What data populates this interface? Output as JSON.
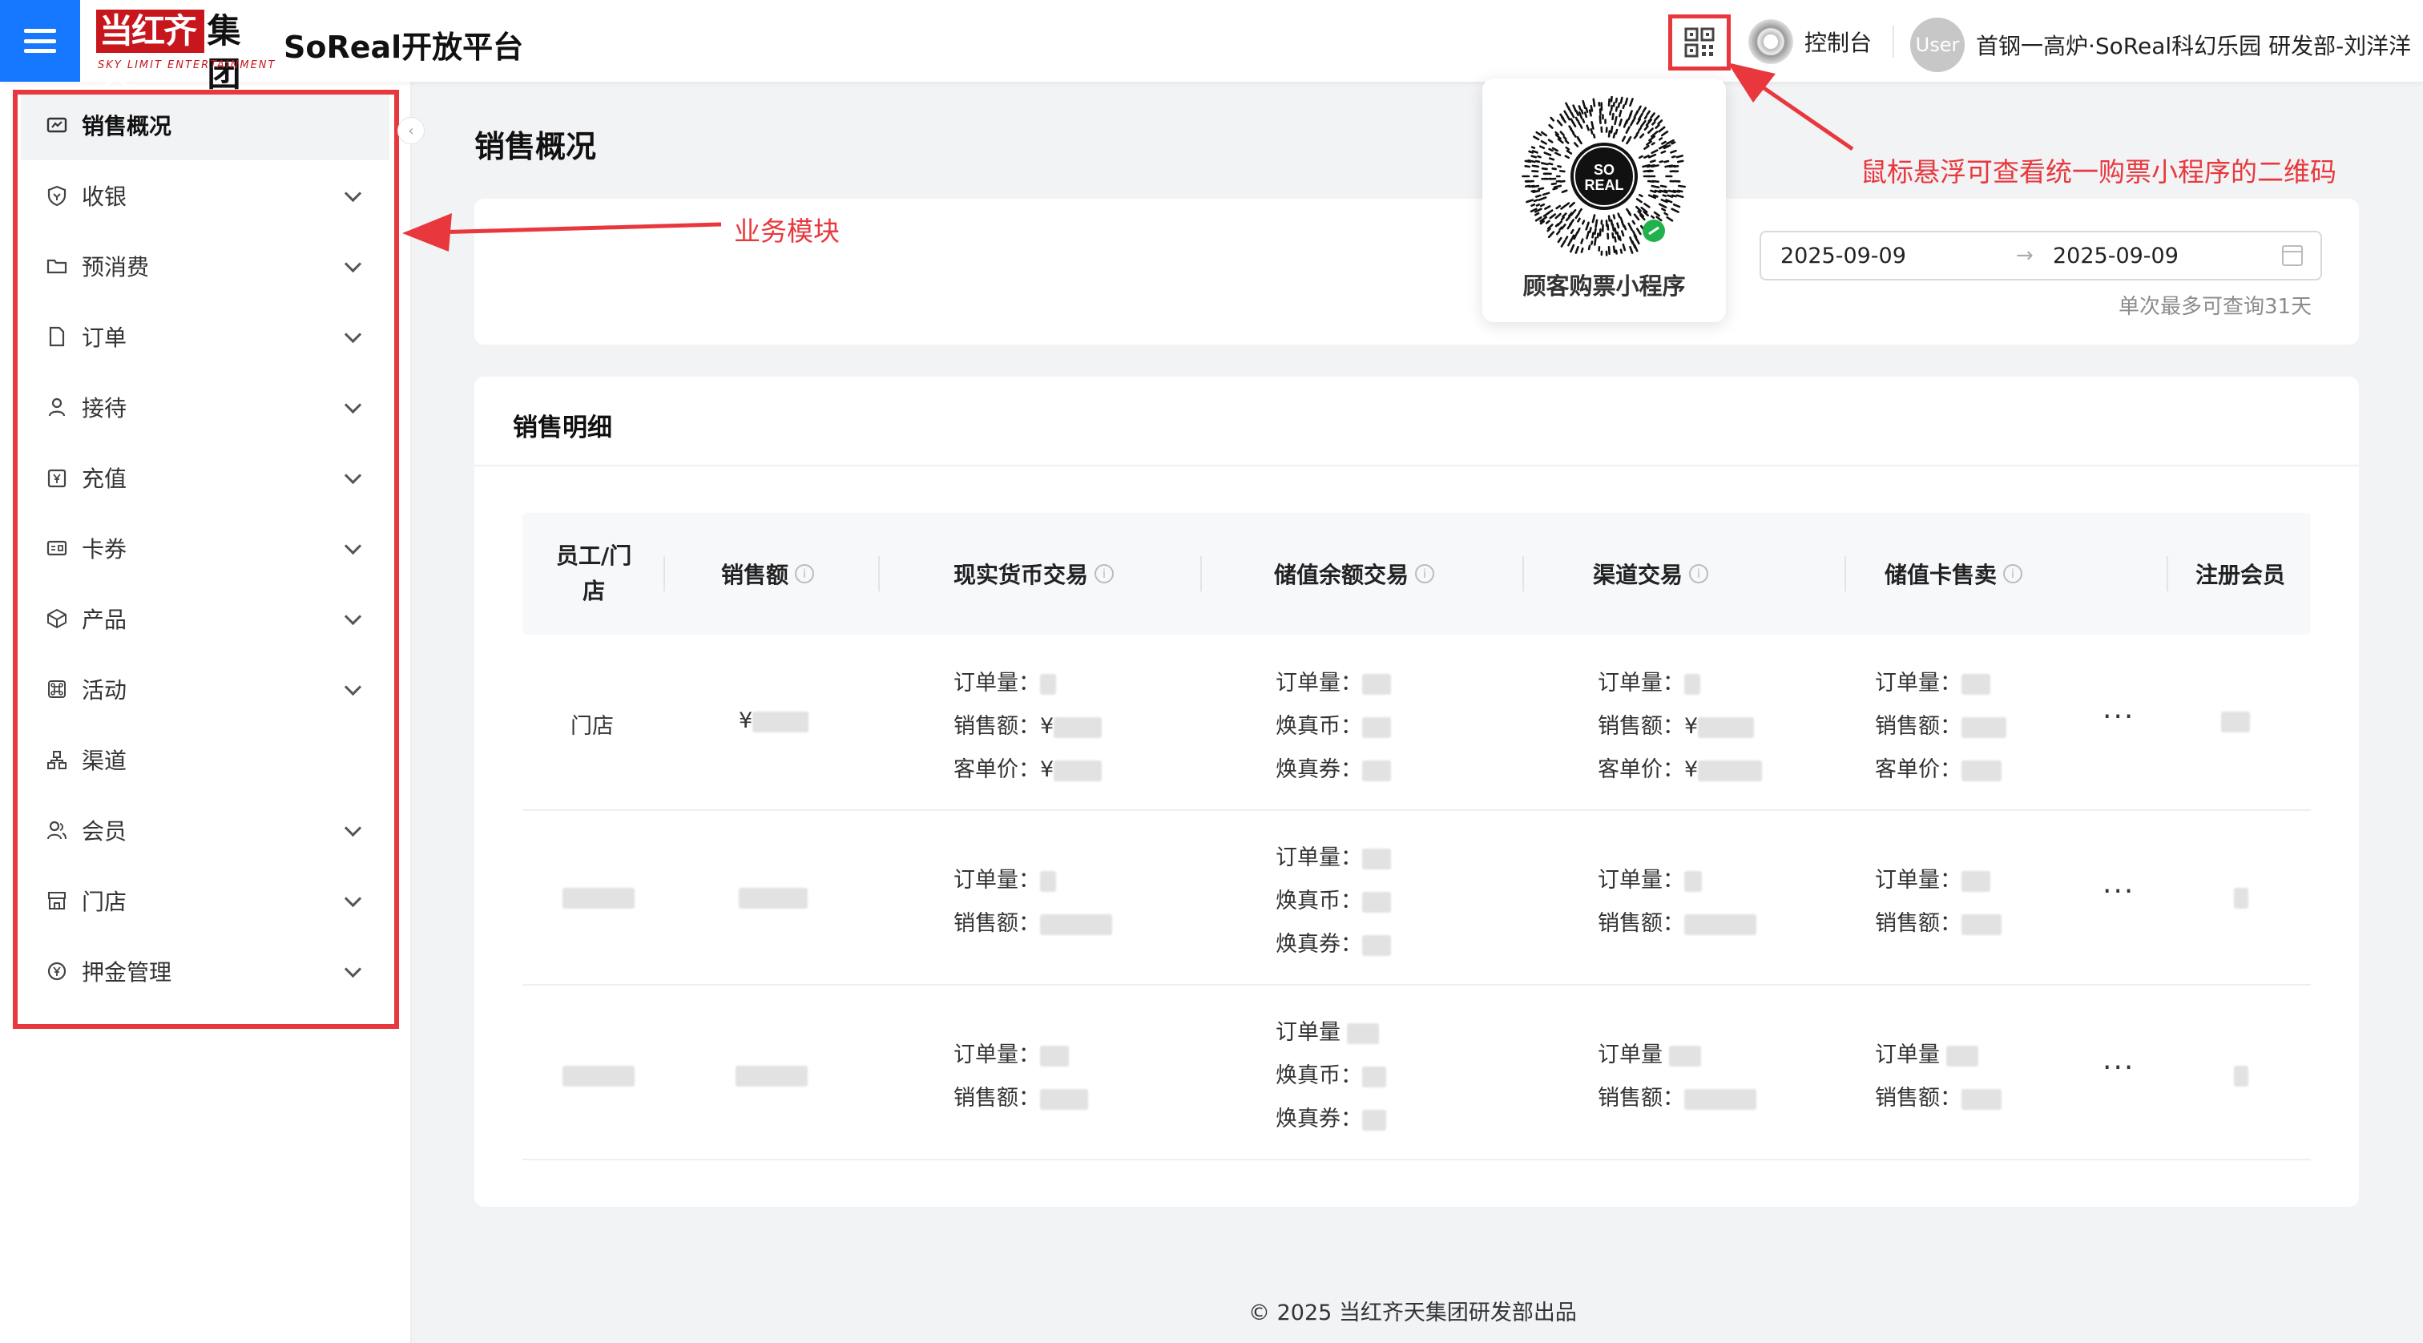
{
  "header": {
    "logo_main": "当红齐天",
    "logo_suffix": "集团",
    "logo_tagline": "SKY LIMIT ENTERTAINMENT",
    "platform_title": "SoReal开放平台",
    "console_label": "控制台",
    "avatar_text": "User",
    "user_name": "首钢一高炉·SoReal科幻乐园 研发部-刘洋洋"
  },
  "qr_popover": {
    "caption": "顾客购票小程序",
    "qr_logo_text": "SO REAL"
  },
  "sidebar": {
    "items": [
      {
        "label": "销售概况",
        "icon": "dashboard-icon",
        "expandable": false,
        "active": true
      },
      {
        "label": "收银",
        "icon": "shield-icon",
        "expandable": true
      },
      {
        "label": "预消费",
        "icon": "folder-icon",
        "expandable": true
      },
      {
        "label": "订单",
        "icon": "file-icon",
        "expandable": true
      },
      {
        "label": "接待",
        "icon": "user-icon",
        "expandable": true
      },
      {
        "label": "充值",
        "icon": "yen-calendar-icon",
        "expandable": true
      },
      {
        "label": "卡券",
        "icon": "id-card-icon",
        "expandable": true
      },
      {
        "label": "产品",
        "icon": "cube-icon",
        "expandable": true
      },
      {
        "label": "活动",
        "icon": "command-icon",
        "expandable": true
      },
      {
        "label": "渠道",
        "icon": "cluster-icon",
        "expandable": false
      },
      {
        "label": "会员",
        "icon": "members-icon",
        "expandable": true
      },
      {
        "label": "门店",
        "icon": "shop-icon",
        "expandable": true
      },
      {
        "label": "押金管理",
        "icon": "deposit-icon",
        "expandable": true
      }
    ]
  },
  "main": {
    "page_title": "销售概况",
    "date_start": "2025-09-09",
    "date_end": "2025-09-09",
    "date_arrow": "→",
    "date_hint": "单次最多可查询31天",
    "detail_title": "销售明细",
    "columns": [
      "员工/门\n店",
      "销售额",
      "现实货币交易",
      "储值余额交易",
      "渠道交易",
      "储值卡售卖",
      "注册会员"
    ],
    "labels": {
      "order_count": "订单量：",
      "order_count_short": "订单量",
      "sales": "销售额：",
      "avg_price": "客单价：",
      "coin": "焕真币：",
      "voucher": "焕真券：",
      "yen_prefix": "¥",
      "more": "···"
    },
    "row1_name": "门店"
  },
  "footer": {
    "text": "2025 当红齐天集团研发部出品",
    "copyright_symbol": "©"
  },
  "annotations": {
    "module_label": "业务模块",
    "qr_hint": "鼠标悬浮可查看统一购票小程序的二维码"
  },
  "colors": {
    "primary": "#1677ff",
    "brand_red": "#c8161d",
    "annotation_red": "#e8383d"
  }
}
